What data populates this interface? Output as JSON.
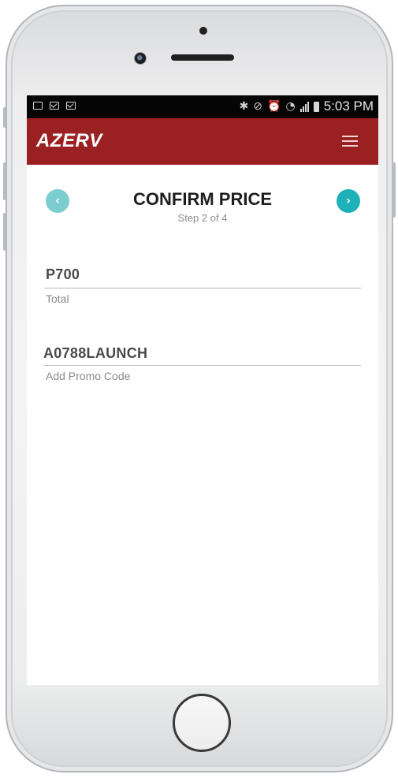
{
  "status_bar": {
    "time": "5:03 PM",
    "left_icons": [
      "image-icon",
      "mail-icon",
      "mail-icon"
    ],
    "right_icons": [
      "bluetooth-icon",
      "mute-icon",
      "alarm-icon",
      "wifi-icon",
      "signal-icon",
      "battery-icon"
    ]
  },
  "app_bar": {
    "logo": "AZERV",
    "menu_icon": "hamburger-menu-icon",
    "color": "#9b2022"
  },
  "header": {
    "title": "CONFIRM PRICE",
    "step": "Step 2 of 4",
    "prev_icon": "chevron-left-icon",
    "next_icon": "chevron-right-icon",
    "prev_color": "#7ccdd0",
    "next_color": "#1fb1b9"
  },
  "form": {
    "total": {
      "value": "P700",
      "label": "Total"
    },
    "promo": {
      "value": "A0788LAUNCH",
      "label": "Add Promo Code"
    }
  }
}
